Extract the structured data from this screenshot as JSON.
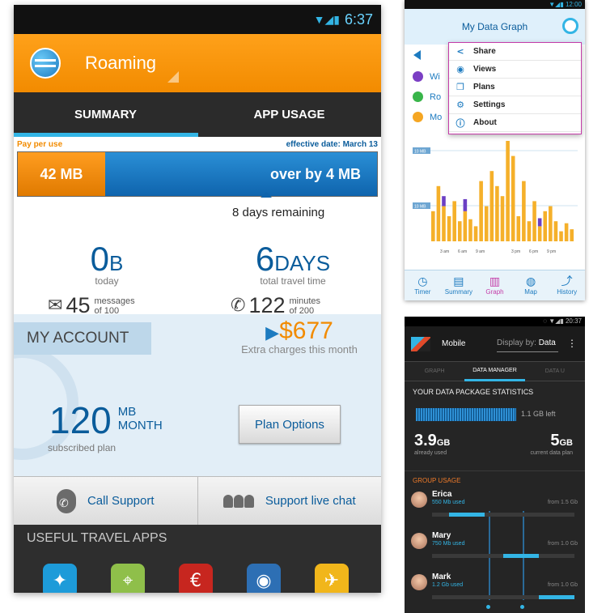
{
  "phone1": {
    "status_time": "6:37",
    "title": "Roaming",
    "tabs": [
      "SUMMARY",
      "APP USAGE"
    ],
    "pay_per_use": "Pay per use",
    "effective_date": "effective date: March 13",
    "used_label": "42 MB",
    "over_label": "over by 4 MB",
    "days_remaining": "8 days remaining",
    "today_value": "0",
    "today_unit": "B",
    "today_label": "today",
    "travel_value": "6",
    "travel_unit": "DAYS",
    "travel_label": "total travel time",
    "messages_count": "45",
    "messages_label": "messages",
    "messages_of": "of 100",
    "minutes_count": "122",
    "minutes_label": "minutes",
    "minutes_of": "of 200",
    "my_account": "MY ACCOUNT",
    "charge_amount": "$677",
    "charge_label": "Extra charges this month",
    "plan_value": "120",
    "plan_unit_top": "MB",
    "plan_unit_bottom": "MONTH",
    "plan_label": "subscribed plan",
    "plan_options": "Plan Options",
    "call_support": "Call Support",
    "live_chat": "Support live chat",
    "apps_header": "USEFUL TRAVEL APPS",
    "apps": [
      {
        "icon": "wifi-star-icon",
        "glyph": "✦",
        "color": "#1d9bd9"
      },
      {
        "icon": "maps-icon",
        "glyph": "⌖",
        "color": "#8fbf4a"
      },
      {
        "icon": "euro-icon",
        "glyph": "€",
        "color": "#c7261f"
      },
      {
        "icon": "owl-icon",
        "glyph": "◉",
        "color": "#2d6fb4"
      },
      {
        "icon": "suitcase-icon",
        "glyph": "✈",
        "color": "#f1b61b"
      }
    ]
  },
  "phone2": {
    "status_time": "12:00",
    "title": "My Data Graph",
    "legend": [
      {
        "label": "Wi",
        "color": "#7b3fc4"
      },
      {
        "label": "Ro",
        "color": "#39b54a"
      },
      {
        "label": "Mo",
        "color": "#f5a623"
      }
    ],
    "menu": [
      {
        "icon": "share-icon",
        "glyph": "<",
        "label": "Share"
      },
      {
        "icon": "eye-icon",
        "glyph": "◉",
        "label": "Views"
      },
      {
        "icon": "plans-icon",
        "glyph": "❐",
        "label": "Plans"
      },
      {
        "icon": "gear-icon",
        "glyph": "⚙",
        "label": "Settings"
      },
      {
        "icon": "info-icon",
        "glyph": "ⓘ",
        "label": "About"
      }
    ],
    "grid_labels": [
      "10 MB",
      "10 MB"
    ],
    "time_labels": [
      "3 am",
      "6 am",
      "9 am",
      "3 pm",
      "6 pm",
      "9 pm"
    ],
    "nav": [
      {
        "icon": "timer-icon",
        "glyph": "◷",
        "label": "Timer"
      },
      {
        "icon": "summary-icon",
        "glyph": "▤",
        "label": "Summary"
      },
      {
        "icon": "graph-icon",
        "glyph": "▥",
        "label": "Graph"
      },
      {
        "icon": "map-icon",
        "glyph": "◍",
        "label": "Map"
      },
      {
        "icon": "history-icon",
        "glyph": "⤴",
        "label": "History"
      }
    ],
    "chart_data": {
      "type": "bar",
      "title": "My Data Graph",
      "series": [
        {
          "name": "Mo",
          "values": [
            30,
            55,
            35,
            25,
            40,
            20,
            30,
            22,
            15,
            60,
            35,
            70,
            55,
            45,
            100,
            85,
            25,
            60,
            20,
            40,
            15,
            30,
            35,
            20,
            10,
            18,
            12
          ]
        },
        {
          "name": "Wi",
          "values": [
            0,
            0,
            10,
            0,
            0,
            0,
            12,
            0,
            0,
            0,
            0,
            0,
            0,
            0,
            0,
            0,
            0,
            0,
            0,
            0,
            8,
            0,
            0,
            0,
            0,
            0,
            0
          ]
        }
      ]
    }
  },
  "phone3": {
    "status_time": "20:37",
    "mobile": "Mobile",
    "display_by": "Display by:",
    "display_value": "Data",
    "tabs": [
      "GRAPH",
      "DATA MANAGER",
      "DATA U"
    ],
    "stats_title": "YOUR DATA PACKAGE STATISTICS",
    "left_label": "1.1 GB left",
    "used_value": "3.9",
    "used_unit": "GB",
    "used_label": "already used",
    "plan_value": "5",
    "plan_unit": "GB",
    "plan_label": "current data plan",
    "group_title": "GROUP USAGE",
    "members": [
      {
        "name": "Erica",
        "used": "550 Mb used",
        "from": "from 1.5 Gb",
        "share": 0.37
      },
      {
        "name": "Mary",
        "used": "750 Mb used",
        "from": "from 1.0 Gb",
        "share": 0.75
      },
      {
        "name": "Mark",
        "used": "1.2 Gb used",
        "from": "from 1.0 Gb",
        "share": 1.0
      }
    ]
  }
}
